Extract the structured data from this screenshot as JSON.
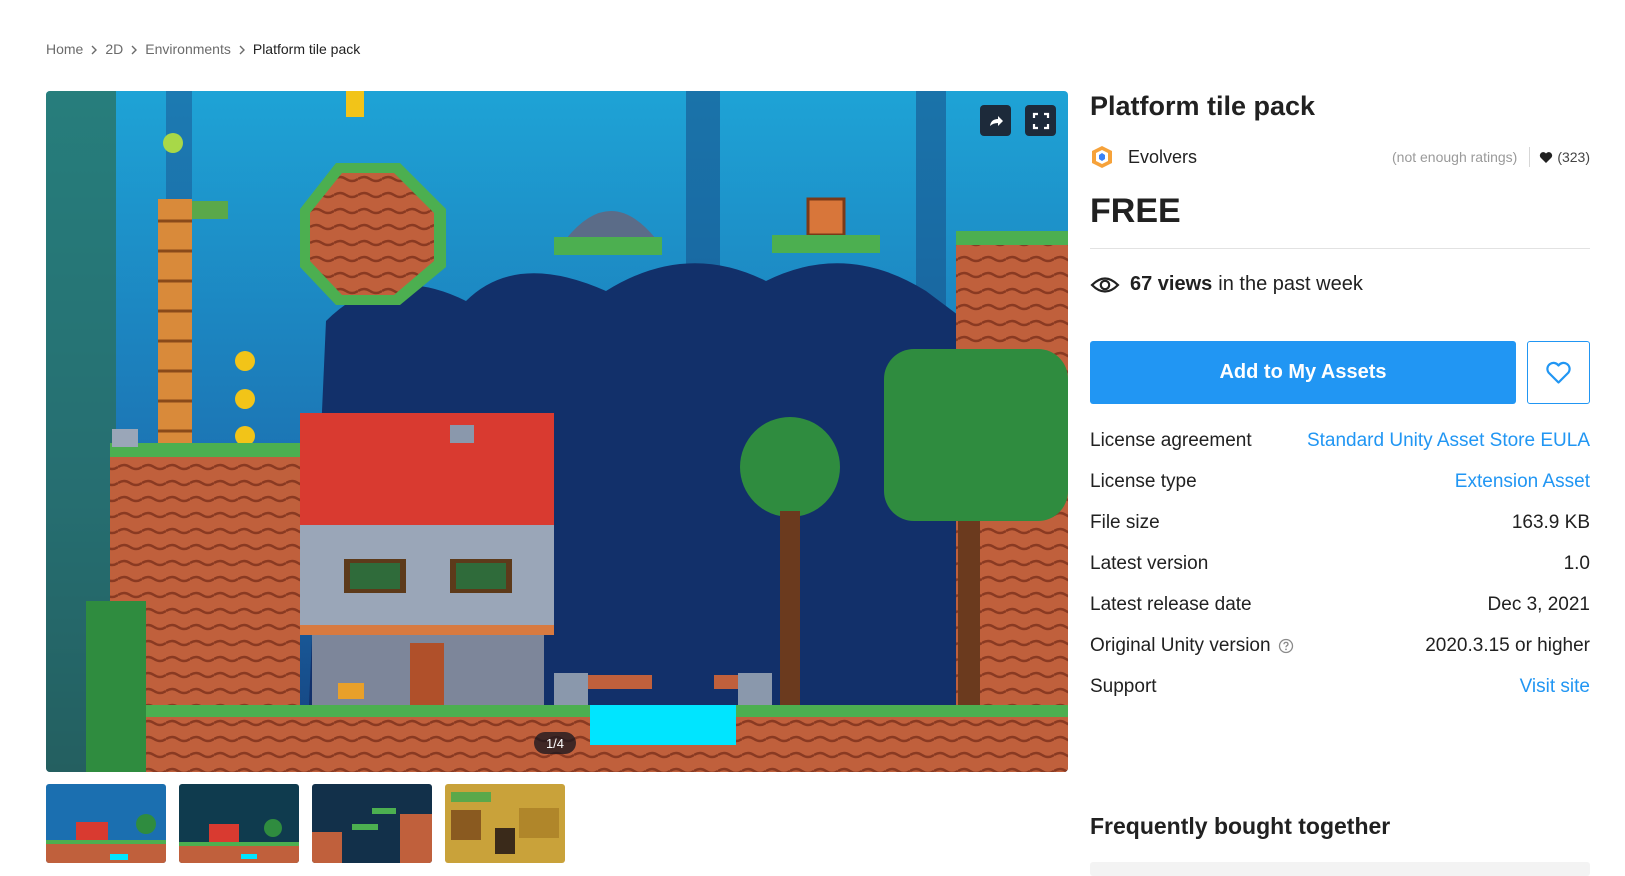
{
  "breadcrumb": {
    "items": [
      "Home",
      "2D",
      "Environments"
    ],
    "current": "Platform tile pack"
  },
  "gallery": {
    "counter": "1/4",
    "share_icon": "share-icon",
    "fullscreen_icon": "fullscreen-icon",
    "thumbnail_count": 4
  },
  "product": {
    "title": "Platform tile pack",
    "publisher": "Evolvers",
    "ratings_text": "(not enough ratings)",
    "favorites_count": "(323)",
    "price": "FREE",
    "views_count": "67 views",
    "views_suffix": "in the past week",
    "add_button_label": "Add to My Assets"
  },
  "details": {
    "license_agreement_label": "License agreement",
    "license_agreement_value": "Standard Unity Asset Store EULA",
    "license_type_label": "License type",
    "license_type_value": "Extension Asset",
    "file_size_label": "File size",
    "file_size_value": "163.9 KB",
    "latest_version_label": "Latest version",
    "latest_version_value": "1.0",
    "release_date_label": "Latest release date",
    "release_date_value": "Dec 3, 2021",
    "unity_version_label": "Original Unity version",
    "unity_version_value": "2020.3.15 or higher",
    "support_label": "Support",
    "support_value": "Visit site"
  },
  "section": {
    "frequently_bought": "Frequently bought together"
  },
  "colors": {
    "accent": "#2196f3",
    "text": "#212121",
    "muted": "#6b6b6b"
  }
}
